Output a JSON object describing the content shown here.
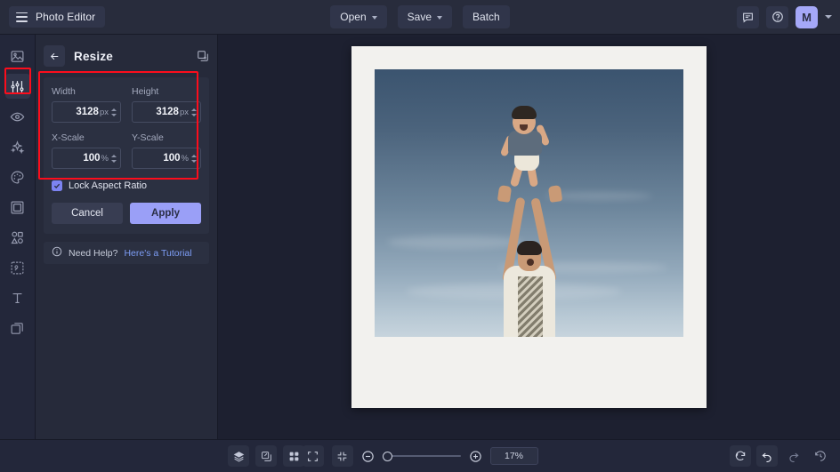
{
  "app": {
    "brand": "Photo Editor",
    "hamburger_icon": "hamburger-icon"
  },
  "topbar": {
    "open_label": "Open",
    "save_label": "Save",
    "batch_label": "Batch",
    "chat_icon": "chat-icon",
    "help_icon": "help-circle-icon",
    "avatar_initial": "M"
  },
  "rail": {
    "items": [
      {
        "icon": "image-icon",
        "name": "sidebar-item-image",
        "selected": false
      },
      {
        "icon": "sliders-icon",
        "name": "sidebar-item-adjust",
        "selected": true
      },
      {
        "icon": "eye-icon",
        "name": "sidebar-item-retouch",
        "selected": false
      },
      {
        "icon": "sparkles-icon",
        "name": "sidebar-item-effects",
        "selected": false
      },
      {
        "icon": "palette-icon",
        "name": "sidebar-item-color",
        "selected": false
      },
      {
        "icon": "frame-icon",
        "name": "sidebar-item-frame",
        "selected": false
      },
      {
        "icon": "shapes-icon",
        "name": "sidebar-item-shapes",
        "selected": false
      },
      {
        "icon": "cutout-icon",
        "name": "sidebar-item-cutout",
        "selected": false
      },
      {
        "icon": "text-icon",
        "name": "sidebar-item-text",
        "selected": false
      },
      {
        "icon": "layers-icon",
        "name": "sidebar-item-layers",
        "selected": false
      }
    ]
  },
  "panel": {
    "back_icon": "back-arrow-icon",
    "title": "Resize",
    "preset_icon": "preset-copy-icon",
    "width": {
      "label": "Width",
      "value": "3128",
      "unit": "px"
    },
    "height": {
      "label": "Height",
      "value": "3128",
      "unit": "px"
    },
    "xscale": {
      "label": "X-Scale",
      "value": "100",
      "unit": "%"
    },
    "yscale": {
      "label": "Y-Scale",
      "value": "100",
      "unit": "%"
    },
    "lock_label": "Lock Aspect Ratio",
    "lock_checked": true,
    "cancel_label": "Cancel",
    "apply_label": "Apply",
    "help_icon": "info-icon",
    "help_text": "Need Help?",
    "help_link": "Here's a Tutorial"
  },
  "bottombar": {
    "layers_icon": "layers-stack-icon",
    "link_icon": "link-icon",
    "grid_icon": "grid-icon",
    "fullscreen_icon": "fullscreen-icon",
    "fit_icon": "fit-screen-icon",
    "zoom_out_icon": "zoom-out-icon",
    "zoom_in_icon": "zoom-in-icon",
    "zoom_value": "17%",
    "reset_icon": "reset-icon",
    "undo_icon": "undo-icon",
    "redo_icon": "redo-icon",
    "history_icon": "history-icon"
  },
  "colors": {
    "accent": "#9a9ff7",
    "highlight": "#fc0d1c",
    "panel_bg": "#262a3a",
    "canvas_bg": "#1d2030",
    "link": "#7d9df5"
  }
}
